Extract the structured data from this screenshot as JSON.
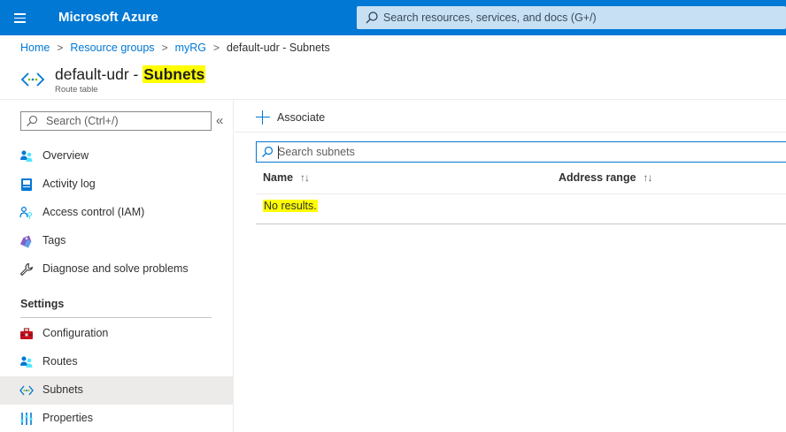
{
  "topbar": {
    "brand": "Microsoft Azure",
    "search_placeholder": "Search resources, services, and docs (G+/)"
  },
  "breadcrumb": {
    "items": [
      "Home",
      "Resource groups",
      "myRG"
    ],
    "current": "default-udr - Subnets",
    "separator": ">"
  },
  "header": {
    "title_prefix": "default-udr - ",
    "title_highlight": "Subnets",
    "subtitle": "Route table",
    "icon": "route-table-icon"
  },
  "sidebar": {
    "search_placeholder": "Search (Ctrl+/)",
    "collapse_glyph": "«",
    "items": [
      {
        "label": "Overview",
        "icon": "overview-icon"
      },
      {
        "label": "Activity log",
        "icon": "activity-log-icon"
      },
      {
        "label": "Access control (IAM)",
        "icon": "iam-icon"
      },
      {
        "label": "Tags",
        "icon": "tag-icon"
      },
      {
        "label": "Diagnose and solve problems",
        "icon": "wrench-icon"
      }
    ],
    "settings_header": "Settings",
    "settings_items": [
      {
        "label": "Configuration",
        "icon": "toolbox-icon"
      },
      {
        "label": "Routes",
        "icon": "routes-icon"
      },
      {
        "label": "Subnets",
        "icon": "subnets-icon",
        "active": true
      },
      {
        "label": "Properties",
        "icon": "properties-icon"
      }
    ]
  },
  "main": {
    "associate_label": "Associate",
    "search_placeholder": "Search subnets",
    "columns": [
      {
        "label": "Name",
        "sort": "↑↓"
      },
      {
        "label": "Address range",
        "sort": "↑↓"
      }
    ],
    "empty_text": "No results."
  },
  "colors": {
    "accent": "#0078d4",
    "highlight": "#ffff00",
    "active_nav": "#edebe9"
  }
}
